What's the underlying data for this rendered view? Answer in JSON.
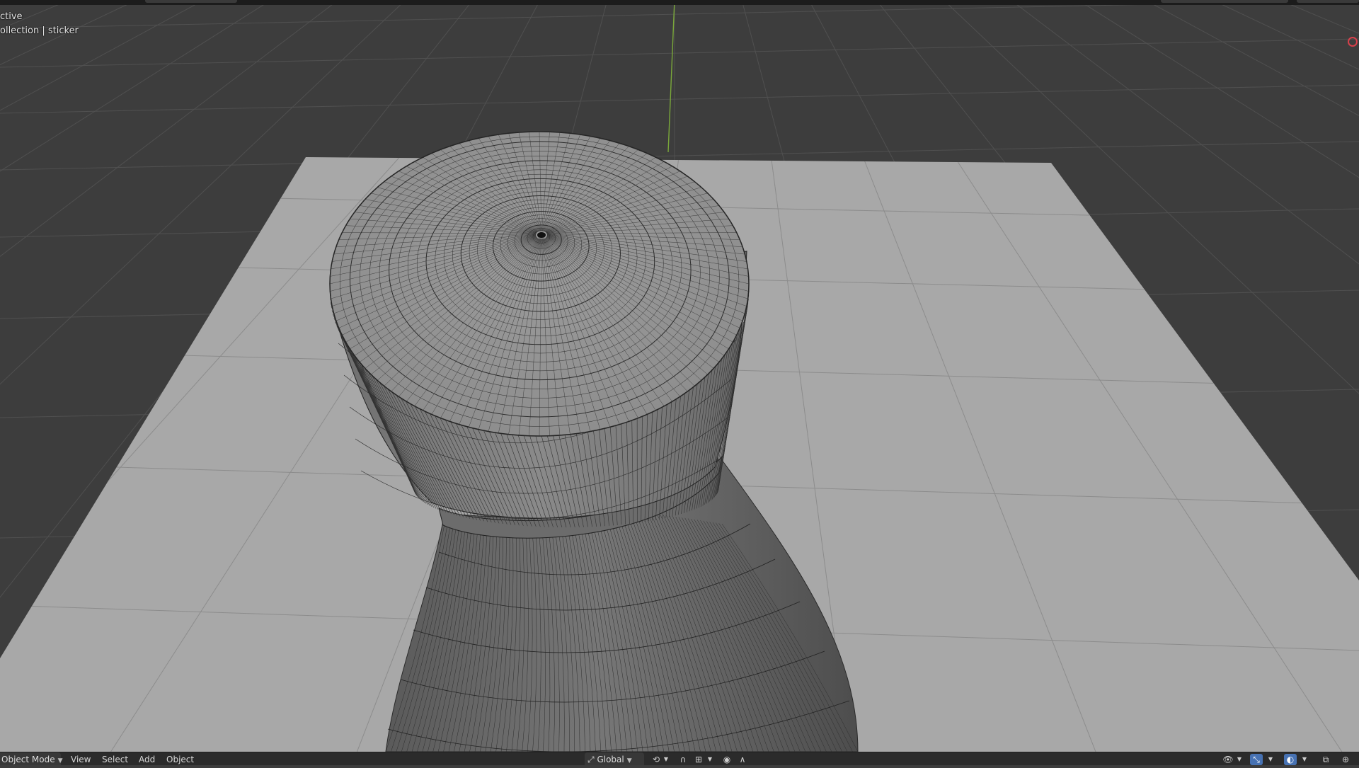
{
  "viewport": {
    "info_line_1": "ctive",
    "info_line_2": "ollection | sticker"
  },
  "header": {
    "mode": "Object Mode",
    "menus": [
      "View",
      "Select",
      "Add",
      "Object"
    ],
    "orientation": "Global"
  },
  "icons": {
    "orientation": "transform-orientation-icon",
    "pivot": "pivot-point-icon",
    "snap": "snap-icon",
    "snap_target": "snap-increment-icon",
    "proportional": "proportional-editing-icon",
    "falloff": "proportional-falloff-icon",
    "visibility": "eye-icon",
    "gizmo": "gizmo-icon",
    "overlays": "overlays-icon",
    "xray": "xray-icon",
    "wireframe_shading": "wireframe-shading-icon"
  },
  "colors": {
    "background": "#3d3d3d",
    "grid_line": "#505050",
    "floor": "#a8a8a8",
    "y_axis": "#7aa83a",
    "x_axis_gizmo": "#d8404b",
    "active_button": "#4772b3"
  }
}
